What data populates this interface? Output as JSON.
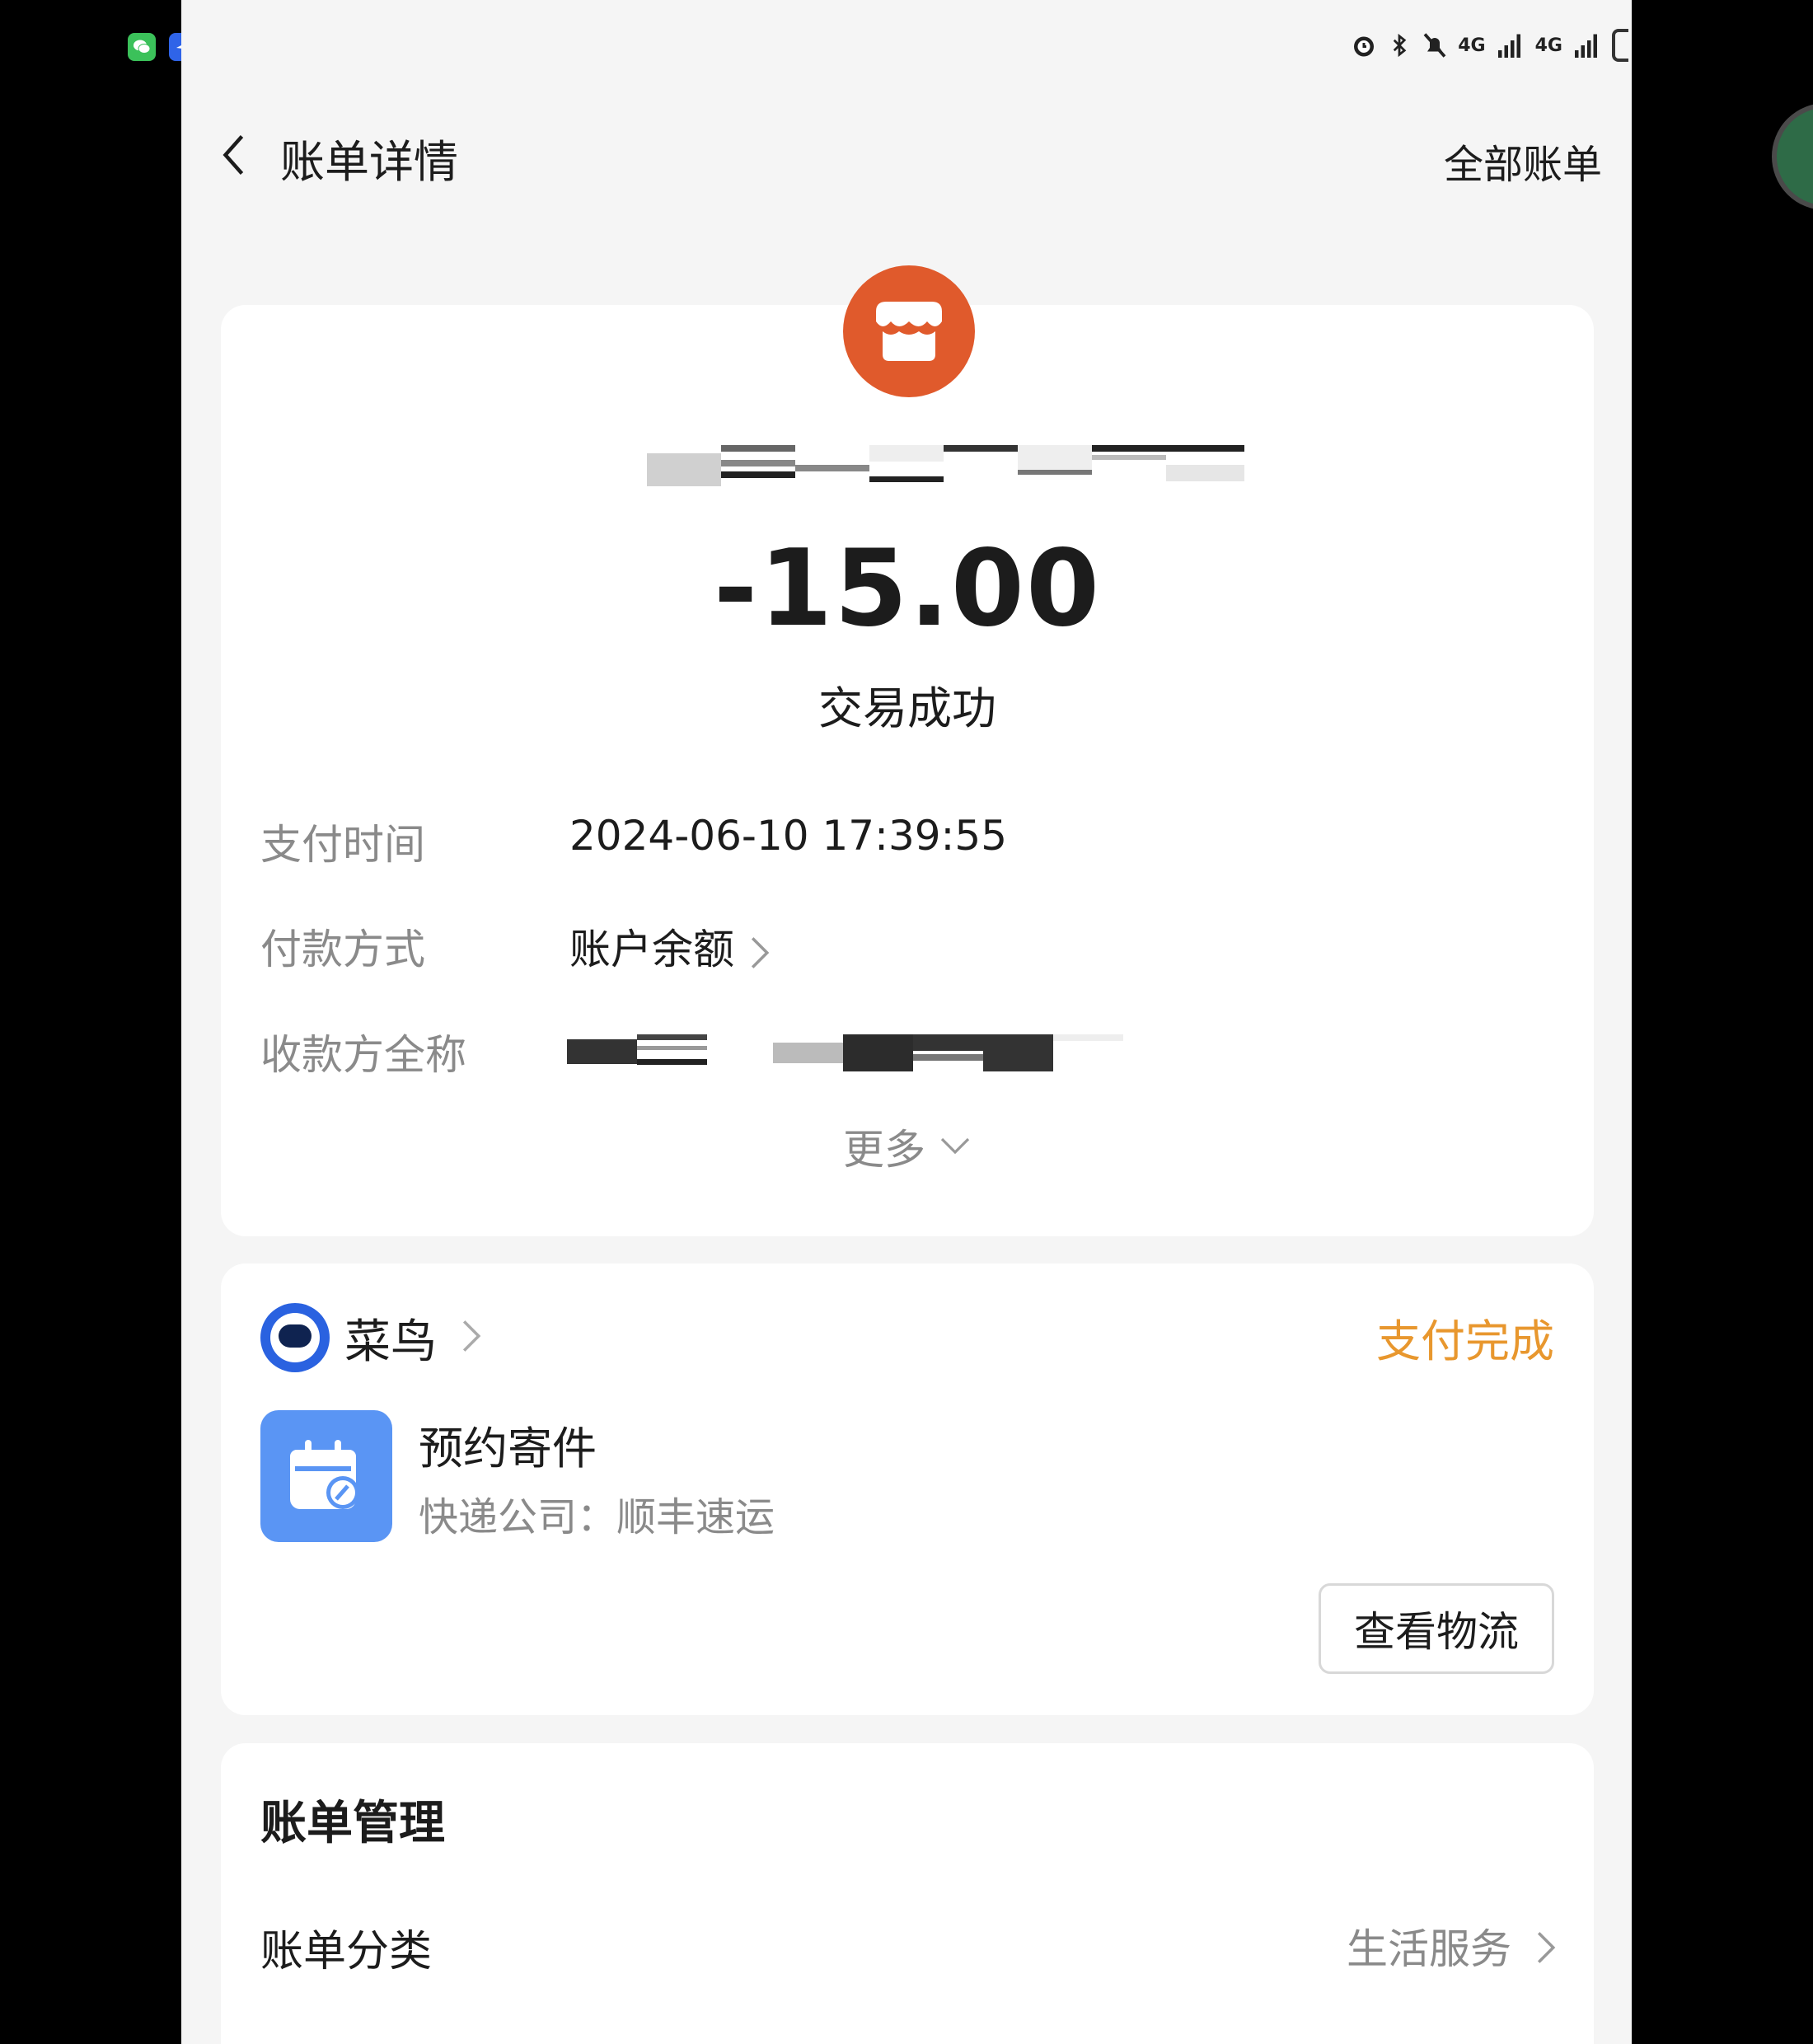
{
  "status_bar": {
    "icons": [
      "alarm-icon",
      "bluetooth-icon",
      "mute-icon",
      "signal-4g-icon",
      "signal-4g-icon",
      "battery-icon"
    ],
    "net1": "4G",
    "net2": "4G"
  },
  "header": {
    "title": "账单详情",
    "all_bills": "全部账单"
  },
  "transaction": {
    "amount": "-15.00",
    "status": "交易成功",
    "merchant_icon": "store-icon",
    "merchant_color": "#e05a2c"
  },
  "details": {
    "time_label": "支付时间",
    "time_value": "2024-06-10 17:39:55",
    "method_label": "付款方式",
    "method_value": "账户余额",
    "payee_label": "收款方全称",
    "more": "更多"
  },
  "cainiao": {
    "name": "菜鸟",
    "status": "支付完成",
    "status_color": "#e8972e",
    "service": "预约寄件",
    "express": "快递公司：顺丰速运",
    "logistics_button": "查看物流"
  },
  "management": {
    "title": "账单管理",
    "category_label": "账单分类",
    "category_value": "生活服务"
  }
}
